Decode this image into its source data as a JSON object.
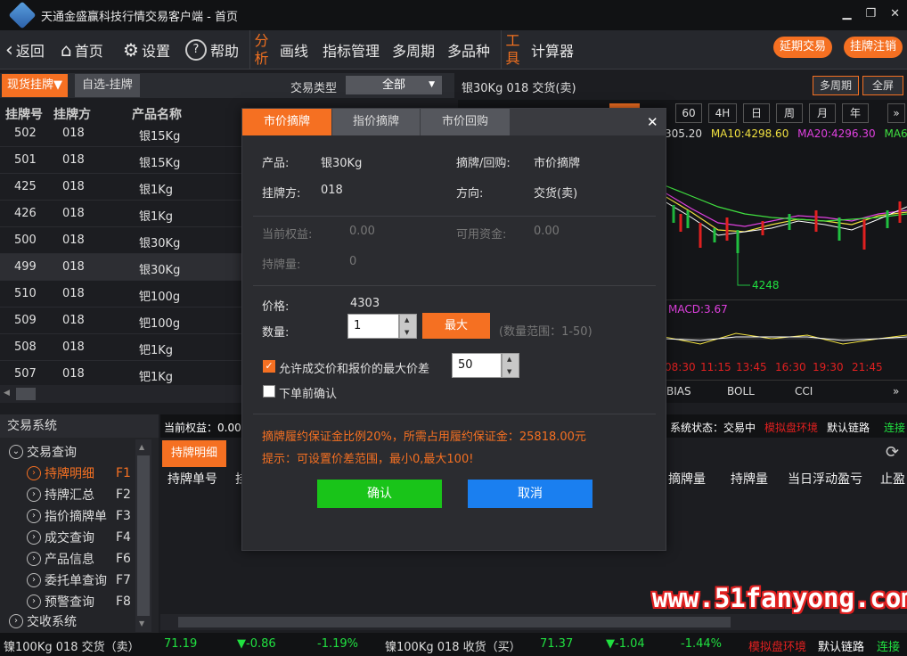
{
  "window": {
    "title": "天通金盛赢科技行情交易客户端 - 首页",
    "minimize": "▁",
    "maximize": "❐",
    "close": "✕"
  },
  "toolbar": {
    "back": "返回",
    "home": "首页",
    "settings": "设置",
    "help": "帮助",
    "analysis_1": "分",
    "analysis_2": "析",
    "draw": "画线",
    "indicator": "指标管理",
    "multi_period": "多周期",
    "multi_product": "多品种",
    "tools_1": "工",
    "tools_2": "具",
    "calculator": "计算器",
    "extend_trade": "延期交易",
    "logout": "挂牌注销"
  },
  "listing": {
    "tab_spot": "现货挂牌▼",
    "tab_fav": "自选-挂牌",
    "trade_type_label": "交易类型",
    "trade_type_value": "全部",
    "headers": [
      "挂牌号",
      "挂牌方",
      "产品名称"
    ],
    "rows": [
      [
        "502",
        "018",
        "银15Kg"
      ],
      [
        "501",
        "018",
        "银15Kg"
      ],
      [
        "425",
        "018",
        "银1Kg"
      ],
      [
        "426",
        "018",
        "银1Kg"
      ],
      [
        "500",
        "018",
        "银30Kg"
      ],
      [
        "499",
        "018",
        "银30Kg"
      ],
      [
        "510",
        "018",
        "钯100g"
      ],
      [
        "509",
        "018",
        "钯100g"
      ],
      [
        "508",
        "018",
        "钯1Kg"
      ],
      [
        "507",
        "018",
        "钯1Kg"
      ]
    ]
  },
  "chart": {
    "title": "银30Kg 018 交货(卖)",
    "multi_period_btn": "多周期",
    "fullscreen_btn": "全屏",
    "periods": [
      "60",
      "4H",
      "日",
      "周",
      "月",
      "年"
    ],
    "next": "»",
    "ma_prefix": "305.20",
    "ma10": "MA10:4298.60",
    "ma20": "MA20:4296.30",
    "ma60": "MA60:4",
    "low_label": "4248",
    "macd": "MACD:3.67",
    "times": [
      "08:30",
      "11:15",
      "13:45",
      "16:30",
      "19:30",
      "21:45"
    ],
    "indicators": [
      "BIAS",
      "BOLL",
      "CCI"
    ],
    "ind_next": "»",
    "colors": {
      "ma10": "#f0e040",
      "ma20": "#e040e0",
      "ma60": "#40e040",
      "up": "#e02020",
      "down": "#20c040"
    }
  },
  "status": {
    "equity": "当前权益：0.00",
    "system": "系统状态：交易中",
    "sim": "模拟盘环境",
    "link": "默认链路",
    "connect": "连接"
  },
  "tradesys": {
    "title": "交易系统",
    "query": "交易查询",
    "items": [
      [
        "持牌明细",
        "F1"
      ],
      [
        "持牌汇总",
        "F2"
      ],
      [
        "指价摘牌单",
        "F3"
      ],
      [
        "成交查询",
        "F4"
      ],
      [
        "产品信息",
        "F6"
      ],
      [
        "委托单查询",
        "F7"
      ],
      [
        "预警查询",
        "F8"
      ]
    ],
    "delivery": "交收系统"
  },
  "holdings": {
    "tab": "持牌明细",
    "headers": [
      "持牌单号",
      "挂",
      "摘牌量",
      "持牌量",
      "当日浮动盈亏",
      "止盈"
    ]
  },
  "ticker": {
    "item1": "镍100Kg 018 交货（卖）",
    "v1": "71.19",
    "c1": "▼-0.86",
    "p1": "-1.19%",
    "item2": "镍100Kg 018 收货（买）",
    "v2": "71.37",
    "c2": "▼-1.04",
    "p2": "-1.44%",
    "sim": "模拟盘环境",
    "link": "默认链路",
    "connect": "连接"
  },
  "dialog": {
    "tabs": [
      "市价摘牌",
      "指价摘牌",
      "市价回购"
    ],
    "close": "✕",
    "product_label": "产品:",
    "product_value": "银30Kg",
    "pick_label": "摘牌/回购:",
    "pick_value": "市价摘牌",
    "lister_label": "挂牌方:",
    "lister_value": "018",
    "direction_label": "方向:",
    "direction_value": "交货(卖)",
    "equity_label": "当前权益:",
    "equity_value": "0.00",
    "funds_label": "可用资金:",
    "funds_value": "0.00",
    "hold_label": "持牌量:",
    "hold_value": "0",
    "price_label": "价格:",
    "price_value": "4303",
    "qty_label": "数量:",
    "qty_value": "1",
    "max_btn": "最大",
    "qty_range": "(数量范围：1-50)",
    "allow_spread_label": "允许成交价和报价的最大价差",
    "spread_value": "50",
    "confirm_before_label": "下单前确认",
    "check_mark": "✓",
    "margin_text": "摘牌履约保证金比例20%，所需占用履约保证金：25818.00元",
    "hint_text": "提示：可设置价差范围，最小0,最大100!",
    "ok": "确认",
    "cancel": "取消"
  },
  "watermark": "www.51fanyong.com"
}
